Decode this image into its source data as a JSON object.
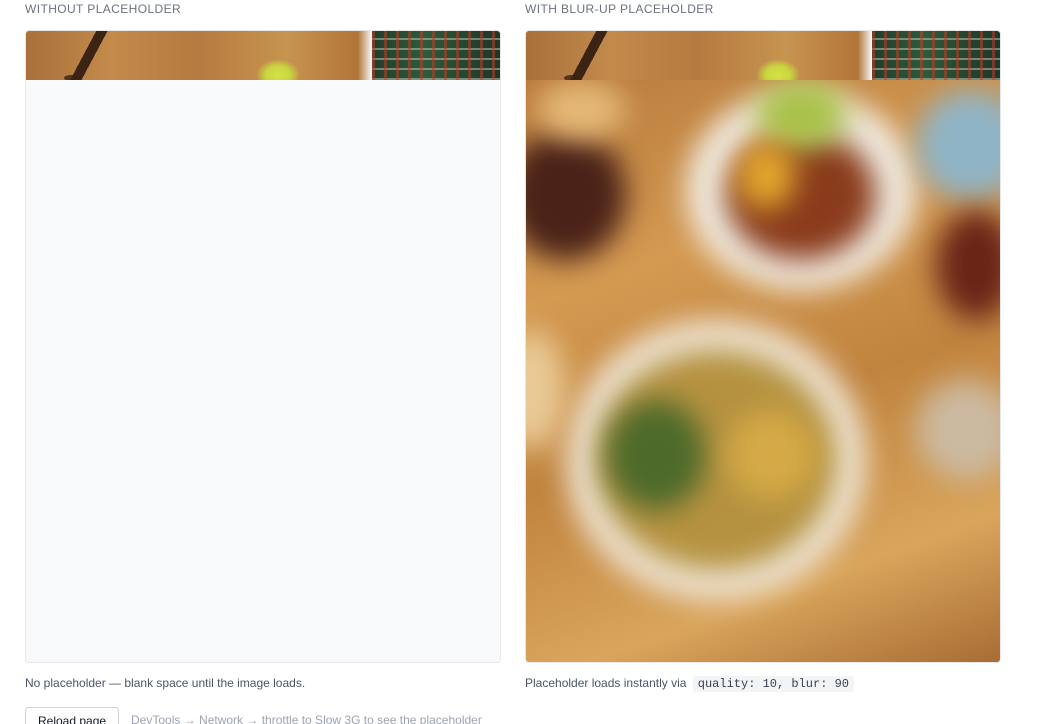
{
  "left_panel": {
    "heading": "WITHOUT PLACEHOLDER",
    "caption": "No placeholder — blank space until the image loads."
  },
  "right_panel": {
    "heading": "WITH BLUR-UP PLACEHOLDER",
    "caption_prefix": "Placeholder loads instantly via",
    "caption_code": "quality: 10, blur: 90"
  },
  "footer": {
    "reload_label": "Reload page",
    "hint": "DevTools → Network → throttle to Slow 3G to see the placeholder"
  },
  "colors": {
    "placeholder_bg": "#f8f9fb",
    "border": "#e5e7eb",
    "muted_text": "#6b7280"
  }
}
